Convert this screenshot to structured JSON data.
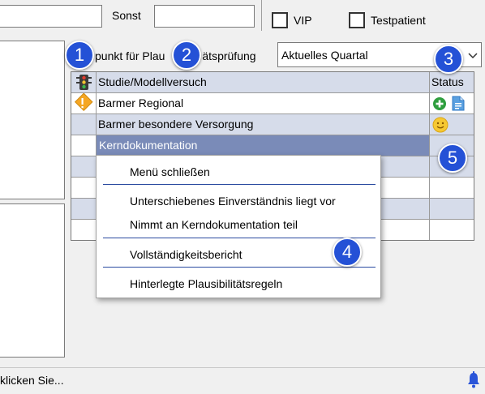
{
  "top": {
    "sonst_label": "Sonst",
    "vip_label": "VIP",
    "testpatient_label": "Testpatient"
  },
  "plausi": {
    "label": "Zeitpunkt für Plausibilitätsprüfung",
    "label_visible": "punkt für Plau",
    "label_visible_end": "ätsprüfung",
    "select_value": "Aktuelles Quartal"
  },
  "table": {
    "headers": [
      "Studie/Modellversuch",
      "Status"
    ],
    "rows": [
      {
        "name": "Barmer Regional"
      },
      {
        "name": "Barmer besondere Versorgung"
      },
      {
        "name": "Kerndokumentation"
      }
    ]
  },
  "context_menu": {
    "items": [
      "Menü schließen",
      "Unterschiebenes Einverständnis liegt vor",
      "Nimmt an Kerndokumentation teil",
      "Vollständigkeitsbericht",
      "Hinterlegte Plausibilitätsregeln"
    ]
  },
  "badges": [
    "1",
    "2",
    "3",
    "4",
    "5"
  ],
  "statusbar": {
    "text": "klicken Sie..."
  },
  "colors": {
    "badge": "#2451d6",
    "selection": "#7a8bb8",
    "alt_row": "#d6dcea",
    "warning": "#f5a623",
    "add_green": "#2e9e3e"
  }
}
